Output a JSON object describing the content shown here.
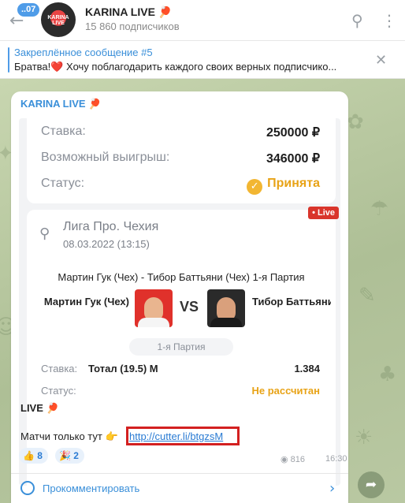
{
  "header": {
    "unread_count": "..07",
    "channel_title": "KARINA LIVE",
    "channel_emoji": "🏓",
    "subscribers": "15 860 подписчиков",
    "avatar_text": "KARINA LIVE"
  },
  "pinned": {
    "title": "Закреплённое сообщение #5",
    "text": "Братва!❤️ Хочу поблагодарить каждого своих верных подписчико..."
  },
  "message": {
    "sender": "KARINA LIVE",
    "sender_emoji": "🏓",
    "bet_summary": {
      "stake_label": "Ставка:",
      "stake_value": "250000 ₽",
      "win_label": "Возможный выигрыш:",
      "win_value": "346000 ₽",
      "status_label": "Статус:",
      "status_value": "Принята"
    },
    "event": {
      "live_badge": "• Live",
      "league": "Лига Про. Чехия",
      "date": "08.03.2022 (13:15)",
      "match_title": "Мартин Гук (Чех) - Тибор Баттьяни (Чех) 1-я Партия",
      "player1": "Мартин Гук (Чех)",
      "player2": "Тибор Баттьяни (Ч...",
      "vs": "VS",
      "period": "1-я Партия",
      "bet_label": "Ставка:",
      "bet_value": "Тотал (19.5) М",
      "odds": "1.384",
      "status_label": "Статус:",
      "status_value": "Не рассчитан"
    },
    "caption_line1": "LIVE 🏓",
    "caption_line2": "Матчи только тут 👉",
    "link": "http://cutter.li/btgzsM",
    "reactions": [
      {
        "emoji": "👍",
        "count": "8"
      },
      {
        "emoji": "🎉",
        "count": "2"
      }
    ],
    "views": "816",
    "time": "16:30",
    "comment_label": "Прокомментировать"
  },
  "colors": {
    "accent": "#3a8fd9",
    "link_highlight": "#d32020",
    "status_orange": "#e8a317",
    "live_red": "#d9352b"
  }
}
